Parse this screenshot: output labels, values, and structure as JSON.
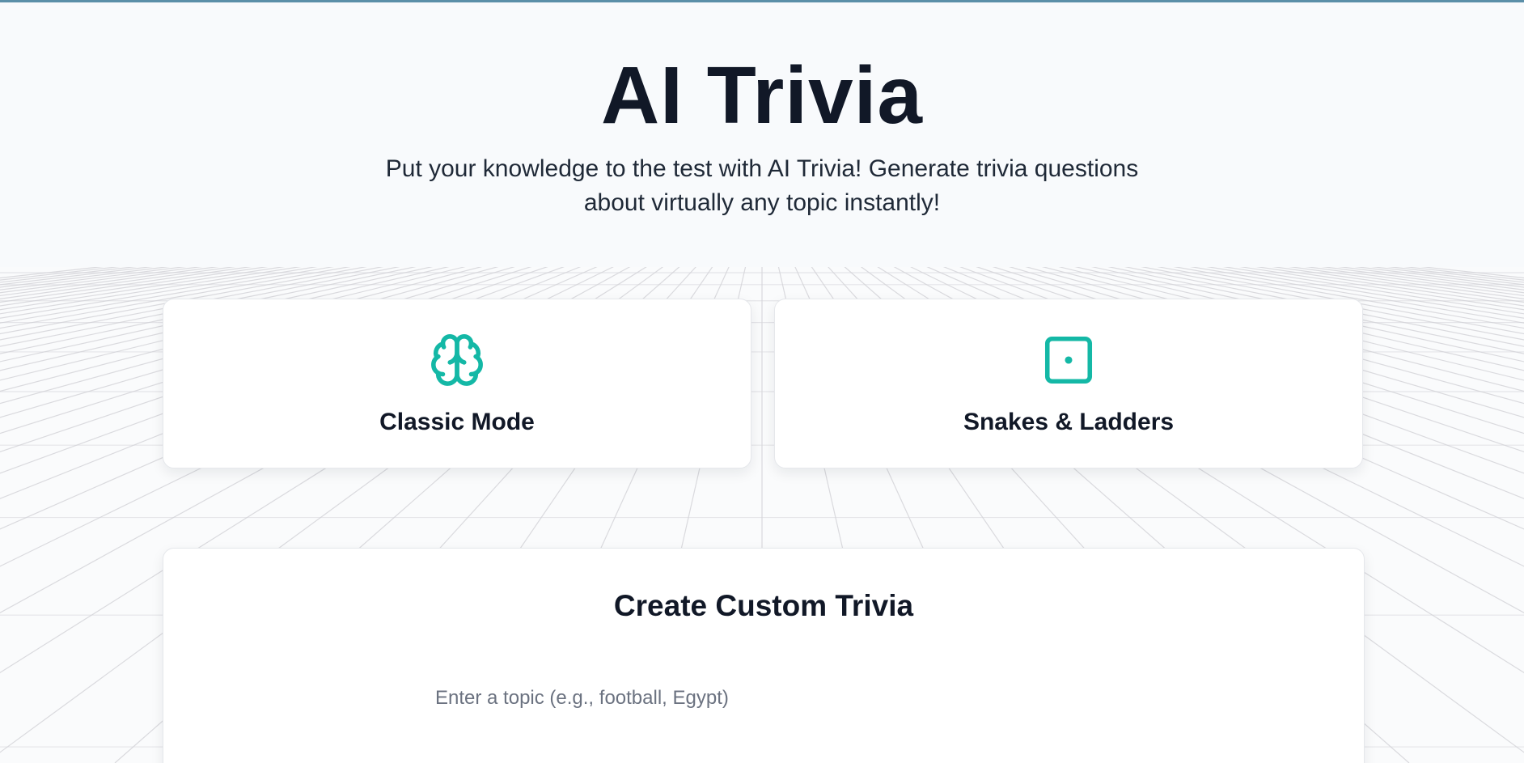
{
  "hero": {
    "title": "AI Trivia",
    "subtitle": "Put your knowledge to the test with AI Trivia! Generate trivia questions about virtually any topic instantly!"
  },
  "modes": [
    {
      "label": "Classic Mode",
      "icon": "brain-icon"
    },
    {
      "label": "Snakes & Ladders",
      "icon": "dice-icon"
    }
  ],
  "custom": {
    "title": "Create Custom Trivia",
    "topic_value": "",
    "topic_placeholder": "Enter a topic (e.g., football, Egypt)"
  },
  "colors": {
    "accent": "#14b8a6",
    "top_bar": "#5b8fa8",
    "text": "#111827",
    "background": "#fafbfc"
  }
}
